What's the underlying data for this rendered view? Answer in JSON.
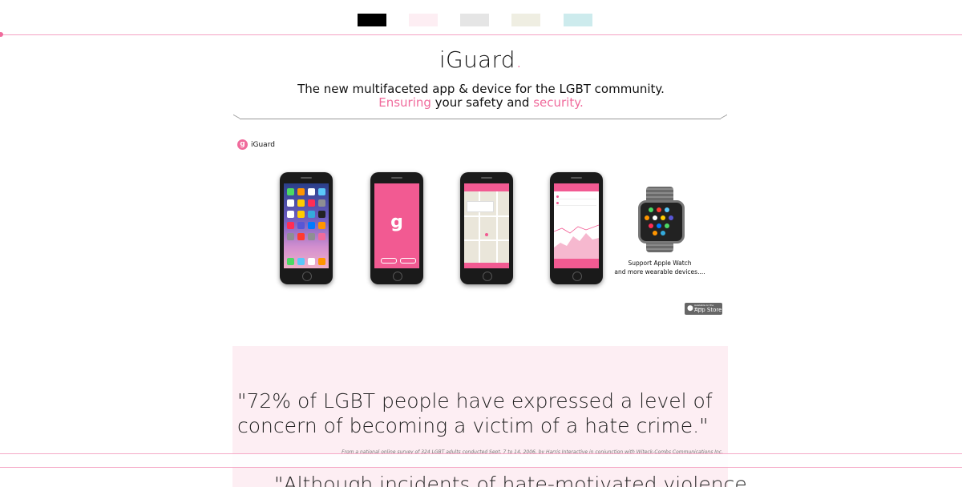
{
  "swatches": [
    {
      "name": "black",
      "color": "#000000"
    },
    {
      "name": "blush",
      "color": "#fdeef3"
    },
    {
      "name": "gray",
      "color": "#e5e5e5"
    },
    {
      "name": "cream",
      "color": "#efeee2"
    },
    {
      "name": "mint",
      "color": "#cdebed"
    }
  ],
  "hero": {
    "title": "iGuard",
    "title_dot": ".",
    "tagline_line1": "The new multifaceted app & device for the LGBT community.",
    "tagline_pink1": "Ensuring",
    "tagline_mid": " your safety and ",
    "tagline_pink2": "security",
    "tagline_end": "."
  },
  "app": {
    "logo_letter": "g",
    "name": "iGuard"
  },
  "phones": [
    {
      "screen": "homescreen-icon"
    },
    {
      "screen": "splash-icon"
    },
    {
      "screen": "map-icon"
    },
    {
      "screen": "stats-icon"
    }
  ],
  "watch": {
    "caption_line1": "Support Apple Watch",
    "caption_line2": "and more wearable devices...."
  },
  "appstore": {
    "top_text": "Available on the iPhone",
    "label": "App Store"
  },
  "quote": {
    "text": "\"72% of LGBT people have expressed a level of concern of becoming a victim of a hate crime.\"",
    "source": "From a national online survey of 324 LGBT adults conducted Sept. 7 to 14, 2006, by Harris Interactive in conjunction with Witeck-Combs Communications Inc.",
    "next": "\"Although incidents of hate-motivated violence"
  },
  "colors": {
    "accent": "#f06b9c",
    "panel": "#fdeef3"
  }
}
